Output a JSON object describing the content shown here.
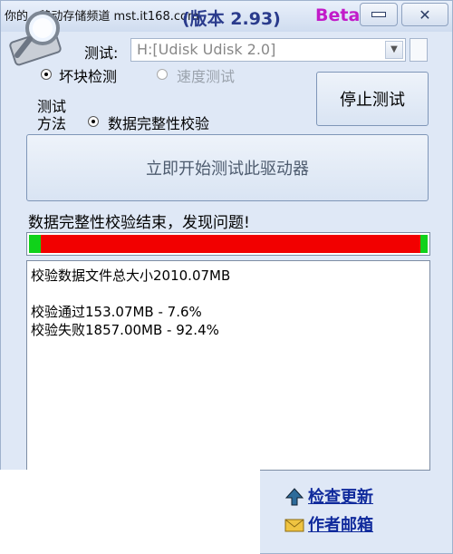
{
  "window": {
    "watermark": "你的 · 移动存储频道 mst.it168.com",
    "version": "(版本 2.93)",
    "beta": "Beta",
    "minimize_label": "",
    "close_label": "✕"
  },
  "drive": {
    "label": "测试:",
    "value": "H:[Udisk Udisk 2.0]"
  },
  "modes": {
    "badblock": "坏块检测",
    "speed": "速度测试"
  },
  "method": {
    "label_line1": "测试",
    "label_line2": "方法",
    "option": "数据完整性校验"
  },
  "buttons": {
    "stop": "停止测试",
    "start": "立即开始测试此驱动器"
  },
  "status": "数据完整性校验结束，发现问题!",
  "progress": {
    "pass_fraction": 0.076,
    "fail_fraction": 0.924,
    "pass_color": "#10d21a",
    "fail_color": "#f20000"
  },
  "log": {
    "line1": "校验数据文件总大小2010.07MB",
    "line2": "",
    "line3": "校验通过153.07MB - 7.6%",
    "line4": "校验失败1857.00MB - 92.4%"
  },
  "links": {
    "update": "检查更新",
    "mail": "作者邮箱",
    "update_icon": "arrow-up-icon",
    "mail_icon": "envelope-icon"
  }
}
